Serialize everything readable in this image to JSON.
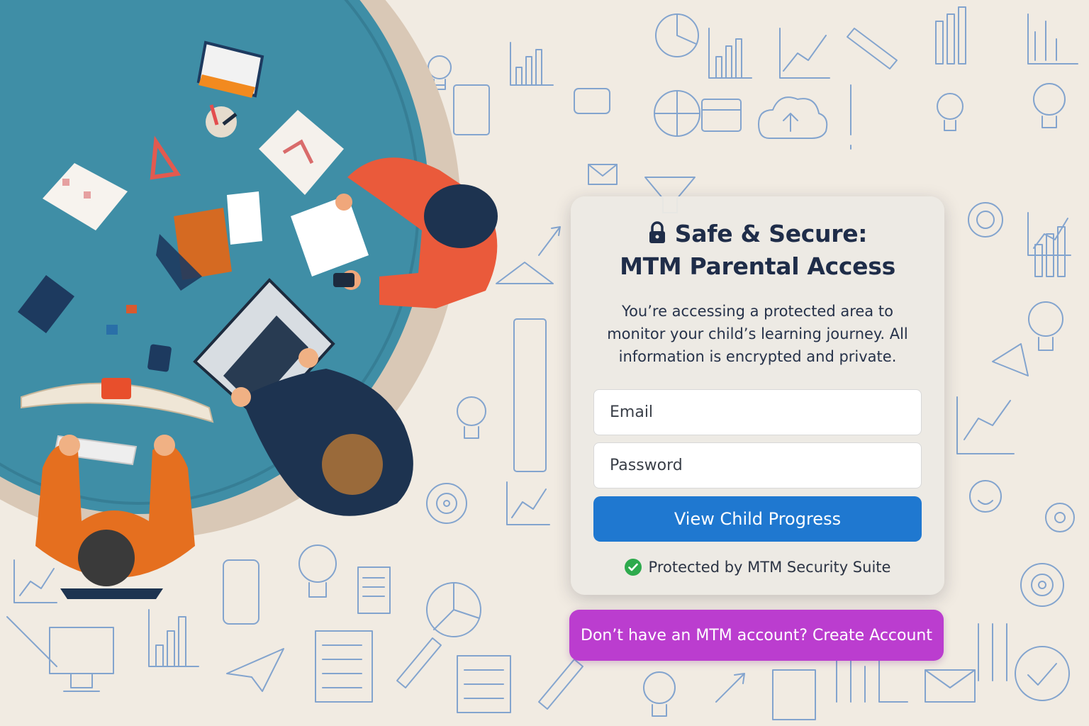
{
  "colors": {
    "background": "#f1ebe2",
    "doodle": "#4f7fc0",
    "table": "#3f8ea6",
    "primary_button": "#1f78d0",
    "create_button": "#bb3dcf",
    "check": "#2eaa4d",
    "title": "#1f2d49"
  },
  "icons": {
    "title_icon": "lock-icon",
    "status_icon": "check-circle-icon"
  },
  "login": {
    "title_line1": "Safe & Secure:",
    "title_line2": "MTM Parental Access",
    "description": "You’re accessing a protected area to monitor your child’s learning journey. All information is encrypted and private.",
    "email_placeholder": "Email",
    "password_placeholder": "Password",
    "submit_label": "View Child Progress",
    "security_note": "Protected by MTM Security Suite"
  },
  "signup": {
    "label": "Don’t have an MTM account? Create Account"
  }
}
